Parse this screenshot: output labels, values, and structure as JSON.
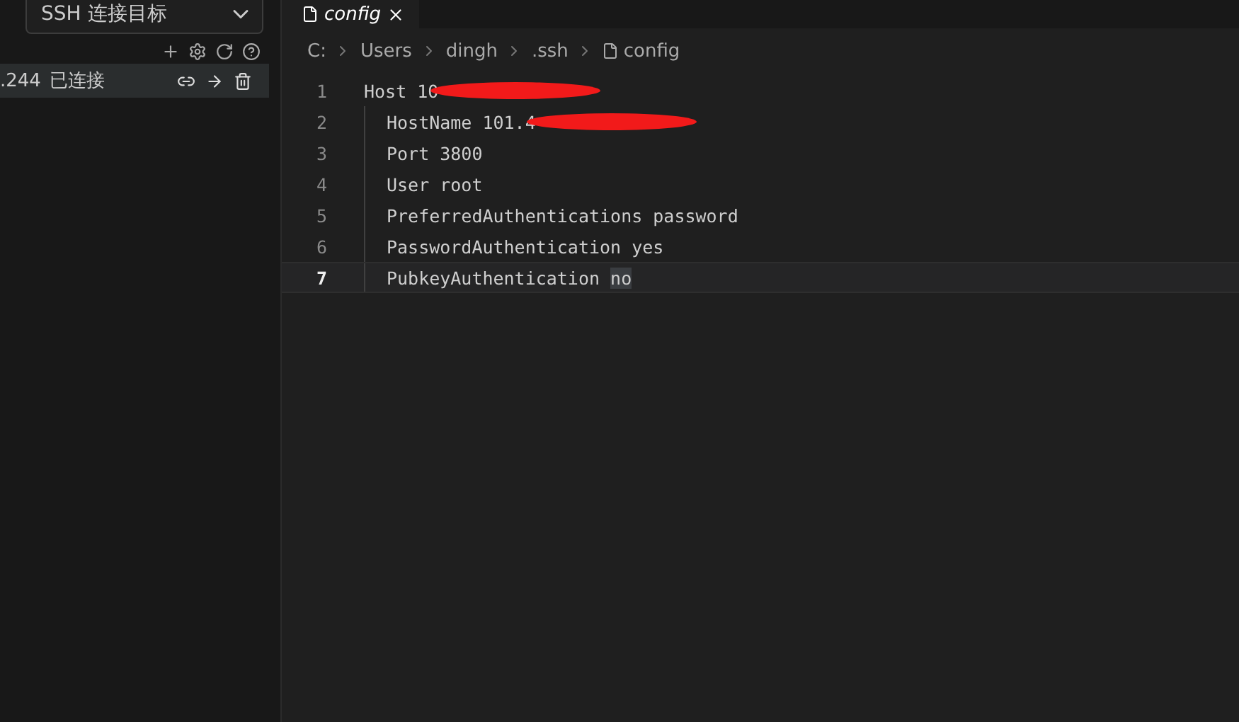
{
  "sidebar": {
    "target_select": {
      "value": "SSH 连接目标"
    },
    "connections": [
      {
        "name": ".244",
        "status": "已连接"
      }
    ]
  },
  "editor": {
    "tabs": [
      {
        "label": "config",
        "selected": true,
        "italic": true
      }
    ],
    "breadcrumb": [
      {
        "text": "C:",
        "file": false
      },
      {
        "text": "Users",
        "file": false
      },
      {
        "text": "dingh",
        "file": false
      },
      {
        "text": ".ssh",
        "file": false
      },
      {
        "text": "config",
        "file": true
      }
    ],
    "lines": [
      {
        "number": "1",
        "indented": false,
        "text": "Host 10",
        "redacted": true,
        "current": false
      },
      {
        "number": "2",
        "indented": true,
        "text": "HostName 101.4",
        "redacted": true,
        "current": false
      },
      {
        "number": "3",
        "indented": true,
        "text": "Port 3800",
        "redacted": false,
        "current": false
      },
      {
        "number": "4",
        "indented": true,
        "text": "User root",
        "redacted": false,
        "current": false
      },
      {
        "number": "5",
        "indented": true,
        "text": "PreferredAuthentications password",
        "redacted": false,
        "current": false
      },
      {
        "number": "6",
        "indented": true,
        "text": "PasswordAuthentication yes",
        "redacted": false,
        "current": false
      },
      {
        "number": "7",
        "indented": true,
        "text": "PubkeyAuthentication ",
        "selection": "no",
        "redacted": false,
        "current": true
      }
    ]
  }
}
